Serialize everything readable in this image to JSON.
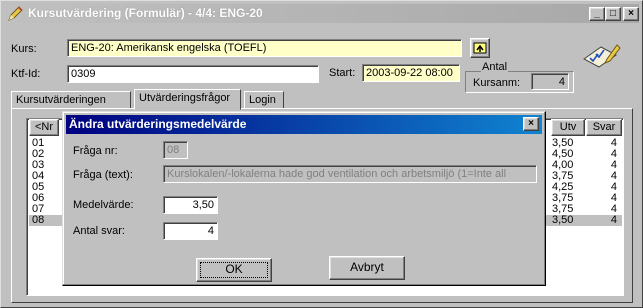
{
  "window": {
    "title": "Kursutvärdering (Formulär) - 4/4: ENG-20",
    "minimize": "_",
    "maximize": "□",
    "close": "×"
  },
  "form": {
    "kurs_label": "Kurs:",
    "kurs_value": "ENG-20: Amerikansk engelska (TOEFL)",
    "ktfid_label": "Ktf-Id:",
    "ktfid_value": "0309",
    "start_label": "Start:",
    "start_value": "2003-09-22 08:00",
    "antal_group_label": "Antal",
    "kursanm_label": "Kursanm:",
    "kursanm_value": "4"
  },
  "tabs": [
    {
      "label": "Kursutvärderingen",
      "active": false
    },
    {
      "label": "Utvärderingsfrågor",
      "active": true
    },
    {
      "label": "Login",
      "active": false
    }
  ],
  "grid": {
    "headers": {
      "nr": "<Nr",
      "utv": "Utv",
      "svar": "Svar"
    },
    "rows": [
      {
        "nr": "01",
        "utv": "3,50",
        "svar": "4"
      },
      {
        "nr": "02",
        "utv": "4,50",
        "svar": "4"
      },
      {
        "nr": "03",
        "utv": "4,00",
        "svar": "4"
      },
      {
        "nr": "04",
        "utv": "3,75",
        "svar": "4"
      },
      {
        "nr": "05",
        "utv": "4,25",
        "svar": "4"
      },
      {
        "nr": "06",
        "utv": "3,75",
        "svar": "4"
      },
      {
        "nr": "07",
        "utv": "3,75",
        "svar": "4"
      },
      {
        "nr": "08",
        "utv": "3,50",
        "svar": "4"
      }
    ]
  },
  "dialog": {
    "title": "Ändra utvärderingsmedelvärde",
    "close": "×",
    "fraga_nr_label": "Fråga nr:",
    "fraga_nr_value": "08",
    "fraga_text_label": "Fråga (text):",
    "fraga_text_value": "Kurslokalen/-lokalerna hade god ventilation och arbetsmiljö (1=Inte all",
    "medelvarde_label": "Medelvärde:",
    "medelvarde_value": "3,50",
    "antal_svar_label": "Antal svar:",
    "antal_svar_value": "4",
    "ok_label": "OK",
    "avbryt_label": "Avbryt"
  },
  "colors": {
    "title_active_start": "#000080",
    "title_active_end": "#1084d0",
    "field_yellow": "#ffffc8"
  }
}
